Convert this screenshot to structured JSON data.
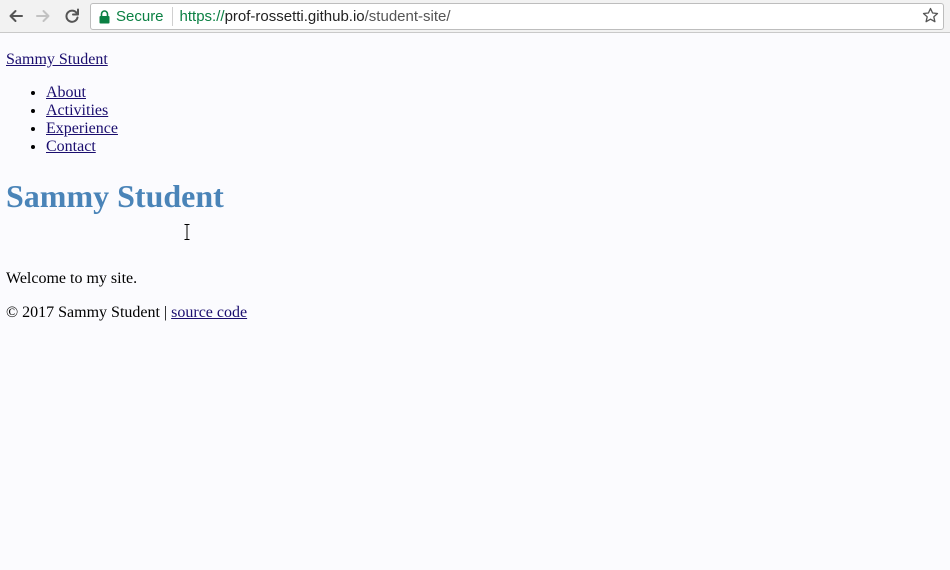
{
  "browser": {
    "secure_label": "Secure",
    "url_scheme": "https://",
    "url_host": "prof-rossetti.github.io",
    "url_path": "/student-site/",
    "icons": [
      "back-arrow-icon",
      "forward-arrow-icon",
      "reload-icon",
      "lock-icon",
      "star-icon"
    ]
  },
  "site": {
    "brand": "Sammy Student",
    "nav": [
      {
        "label": "About"
      },
      {
        "label": "Activities"
      },
      {
        "label": "Experience"
      },
      {
        "label": "Contact"
      }
    ],
    "heading": "Sammy Student",
    "welcome": "Welcome to my site.",
    "footer": {
      "copyright": "© 2017 Sammy Student | ",
      "link_label": "source code"
    }
  },
  "colors": {
    "link": "#1a0d6e",
    "heading": "#4a84b8",
    "secure": "#0b8043"
  }
}
